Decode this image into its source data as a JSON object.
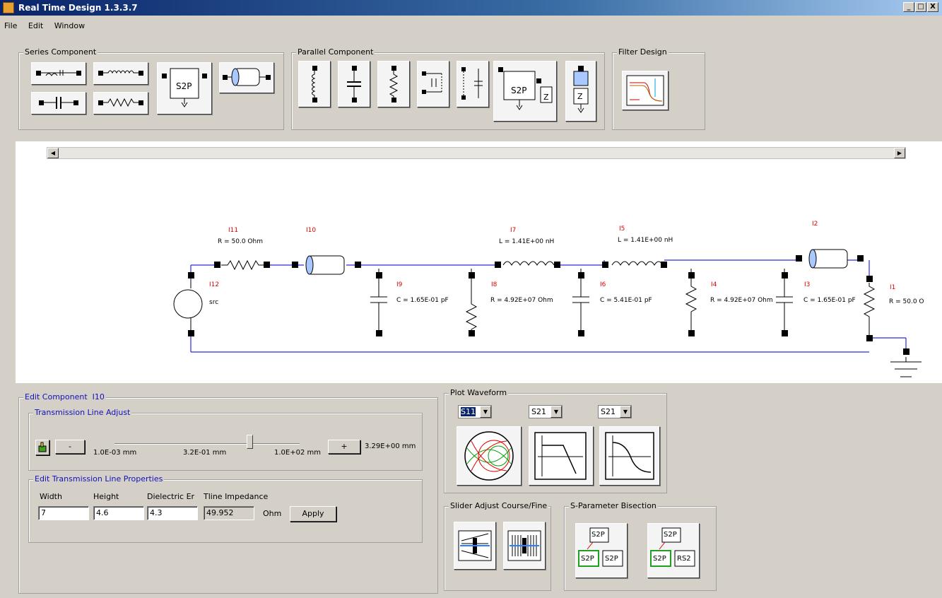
{
  "window": {
    "title": "Real Time Design 1.3.3.7",
    "controls": [
      "_",
      "□",
      "X"
    ]
  },
  "menu": [
    "File",
    "Edit",
    "Window"
  ],
  "series": {
    "label": "Series Component",
    "s2p": "S2P"
  },
  "parallel": {
    "label": "Parallel Component",
    "s2p": "S2P",
    "z": "Z"
  },
  "filter": {
    "label": "Filter Design"
  },
  "circuit": {
    "I11": {
      "id": "I11",
      "value": "R = 50.0 Ohm"
    },
    "I10": {
      "id": "I10"
    },
    "I7": {
      "id": "I7",
      "value": "L = 1.41E+00 nH"
    },
    "I5": {
      "id": "I5",
      "value": "L = 1.41E+00 nH"
    },
    "I2": {
      "id": "I2"
    },
    "I12": {
      "id": "I12",
      "value": "src"
    },
    "I9": {
      "id": "I9",
      "value": "C = 1.65E-01 pF"
    },
    "I8": {
      "id": "I8",
      "value": "R = 4.92E+07 Ohm"
    },
    "I6": {
      "id": "I6",
      "value": "C = 5.41E-01 pF"
    },
    "I4": {
      "id": "I4",
      "value": "R = 4.92E+07 Ohm"
    },
    "I3": {
      "id": "I3",
      "value": "C = 1.65E-01 pF"
    },
    "I1": {
      "id": "I1",
      "value": "R = 50.0 O"
    }
  },
  "edit": {
    "label": "Edit Component",
    "component": "I10",
    "adjust_label": "Transmission Line Adjust",
    "minus": "-",
    "plus": "+",
    "min": "1.0E-03 mm",
    "mid": "3.2E-01 mm",
    "max": "1.0E+02 mm",
    "current": "3.29E+00 mm",
    "slider_fraction": 0.73,
    "props_label": "Edit Transmission Line Properties",
    "width_label": "Width",
    "height_label": "Height",
    "er_label": "Dielectric Er",
    "imp_label": "Tline  Impedance",
    "width": "7",
    "height": "4.6",
    "er": "4.3",
    "impedance": "49.952",
    "unit": "Ohm",
    "apply": "Apply"
  },
  "plot": {
    "label": "Plot Waveform",
    "sel1": "S11",
    "sel2": "S21",
    "sel3": "S21"
  },
  "slider_adjust": {
    "label": "Slider Adjust Course/Fine"
  },
  "bisection": {
    "label": "S-Parameter Bisection",
    "s2p": "S2P",
    "rs2": "RS2"
  },
  "colors": {
    "wire": "#2a2ae0",
    "label_red": "#e00000",
    "group_blue": "#1010c0"
  }
}
